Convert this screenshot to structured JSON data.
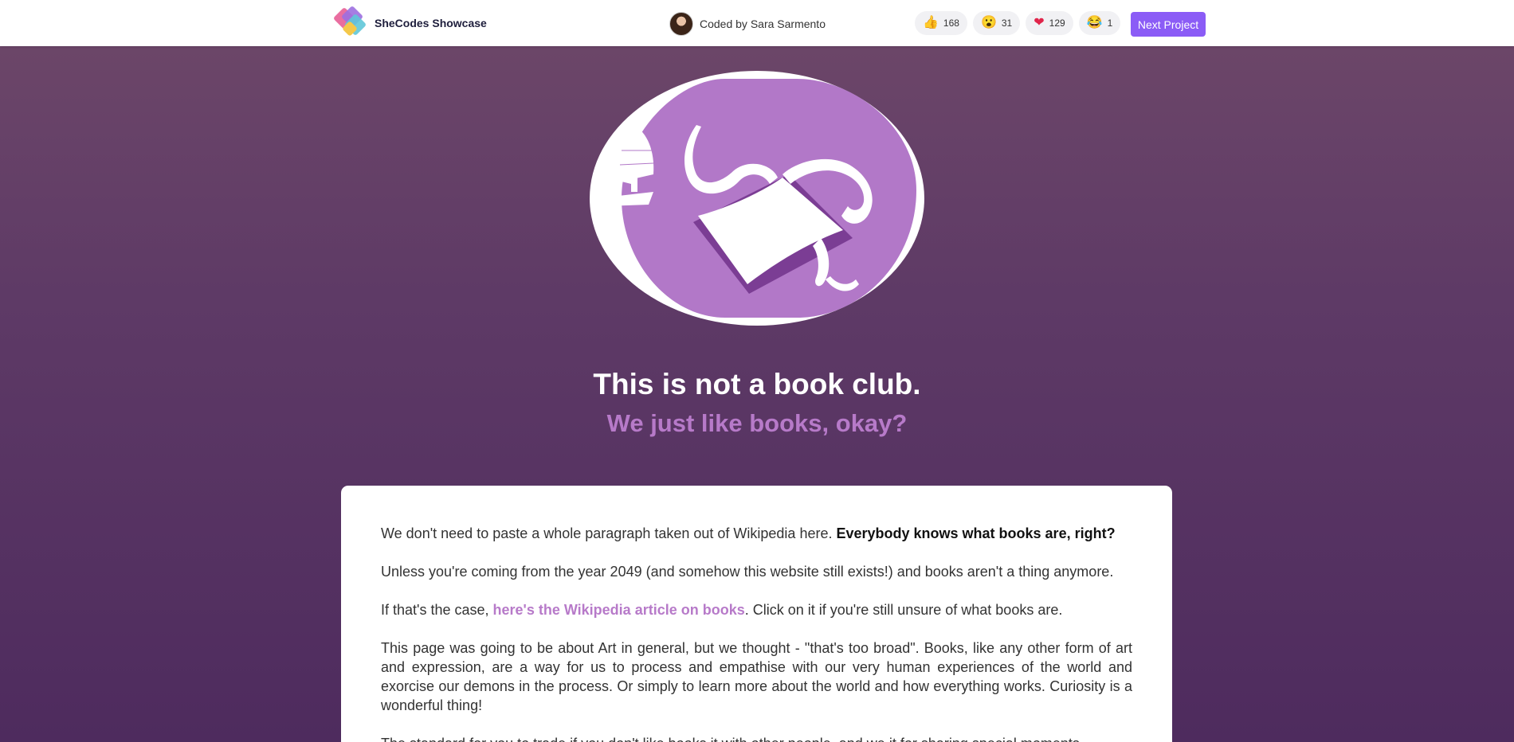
{
  "topbar": {
    "brand_name": "SheCodes Showcase",
    "coder_label": "Coded by Sara Sarmento",
    "reactions": [
      {
        "emoji": "👍",
        "count": "168"
      },
      {
        "emoji": "😮",
        "count": "31"
      },
      {
        "emoji": "❤",
        "count": "129"
      },
      {
        "emoji": "😂",
        "count": "1"
      }
    ],
    "next_label": "Next Project"
  },
  "hero": {
    "title": "This is not a book club.",
    "subtitle": "We just like books, okay?"
  },
  "content": {
    "p1_text": "We don't need to paste a whole paragraph taken out of Wikipedia here. ",
    "p1_bold": "Everybody knows what books are, right?",
    "p2": "Unless you're coming from the year 2049 (and somehow this website still exists!) and books aren't a thing anymore.",
    "p3_before": "If that's the case, ",
    "p3_link": "here's the Wikipedia article on books",
    "p3_after": ". Click on it if you're still unsure of what books are.",
    "p4": "This page was going to be about Art in general, but we thought - \"that's too broad\". Books, like any other form of art and expression, are a way for us to process and empathise with our very human experiences of the world and exorcise our demons in the process. Or simply to learn more about the world and how everything works. Curiosity is a wonderful thing!",
    "p5": "The standard for you to trade if you don't like books it with other people, and we it for sharing special moments"
  },
  "colors": {
    "accent": "#8b5cf6",
    "highlight": "#b77ac9",
    "logo_fill": "#b278c8",
    "book_shadow": "#7b3d94"
  }
}
